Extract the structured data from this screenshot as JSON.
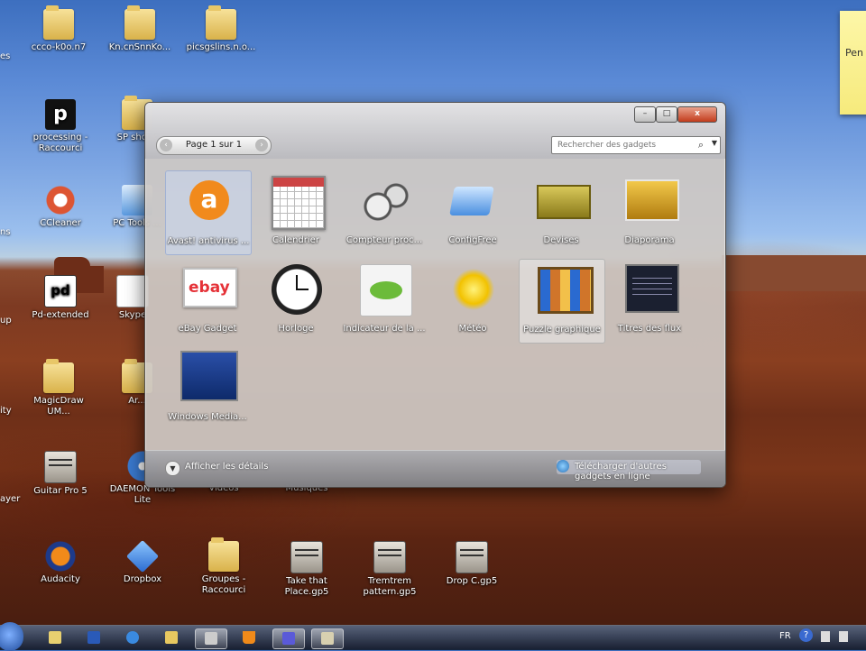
{
  "desktop": {
    "icons": [
      {
        "label": "ccco-k0o.n7",
        "kind": "folder"
      },
      {
        "label": "Kn.cnSnnKo...",
        "kind": "folder"
      },
      {
        "label": "picsgslins.n.o...",
        "kind": "folder"
      },
      {
        "label": "processing - Raccourci",
        "kind": "app"
      },
      {
        "label": "SP shcuk",
        "kind": "folder"
      },
      {
        "label": "CCleaner",
        "kind": "app"
      },
      {
        "label": "PC Tools ...",
        "kind": "app"
      },
      {
        "label": "Pd-extended",
        "kind": "app"
      },
      {
        "label": "Skype",
        "kind": "app"
      },
      {
        "label": "MagicDraw UM...",
        "kind": "folder"
      },
      {
        "label": "Ar...",
        "kind": "folder"
      },
      {
        "label": "Guitar Pro 5",
        "kind": "gtp"
      },
      {
        "label": "DAEMON Tools Lite",
        "kind": "app"
      },
      {
        "label": "Vidéos",
        "kind": "folder"
      },
      {
        "label": "Musiques",
        "kind": "folder"
      },
      {
        "label": "Audacity",
        "kind": "app"
      },
      {
        "label": "Dropbox",
        "kind": "app"
      },
      {
        "label": "Groupes - Raccourci",
        "kind": "folder"
      },
      {
        "label": "Take that Place.gp5",
        "kind": "gtp"
      },
      {
        "label": "Tremtrem pattern.gp5",
        "kind": "gtp"
      },
      {
        "label": "Drop C.gp5",
        "kind": "gtp"
      }
    ],
    "edge_labels": [
      "es",
      "ns",
      "up",
      "ity",
      "ayer"
    ],
    "sticky_note": "Pen"
  },
  "gadget_window": {
    "pager": {
      "prev": "‹",
      "text": "Page 1 sur 1",
      "next": "›"
    },
    "search_placeholder": "Rechercher des gadgets",
    "gadgets": [
      {
        "label": "Avast! antivirus ...",
        "icon": "avast-icon",
        "state": "selected"
      },
      {
        "label": "Calendrier",
        "icon": "calendar-icon",
        "state": ""
      },
      {
        "label": "Compteur proc...",
        "icon": "cpu-meter-icon",
        "state": ""
      },
      {
        "label": "ConfigFree",
        "icon": "configfree-icon",
        "state": ""
      },
      {
        "label": "Devises",
        "icon": "currency-icon",
        "state": ""
      },
      {
        "label": "Diaporama",
        "icon": "slideshow-icon",
        "state": ""
      },
      {
        "label": "eBay Gadget",
        "icon": "ebay-icon",
        "state": ""
      },
      {
        "label": "Horloge",
        "icon": "clock-icon",
        "state": ""
      },
      {
        "label": "Indicateur de la ...",
        "icon": "indicator-icon",
        "state": ""
      },
      {
        "label": "Météo",
        "icon": "weather-icon",
        "state": ""
      },
      {
        "label": "Puzzle graphique",
        "icon": "puzzle-icon",
        "state": "hover"
      },
      {
        "label": "Titres des flux",
        "icon": "feed-headlines-icon",
        "state": ""
      },
      {
        "label": "Windows Media...",
        "icon": "windows-media-icon",
        "state": ""
      }
    ],
    "footer": {
      "details_label": "Afficher les détails",
      "online_label": "Télécharger d'autres gadgets en ligne"
    },
    "buttons": {
      "minimize": "–",
      "maximize": "□",
      "close": "x"
    }
  },
  "taskbar": {
    "language": "FR",
    "help": "?"
  }
}
